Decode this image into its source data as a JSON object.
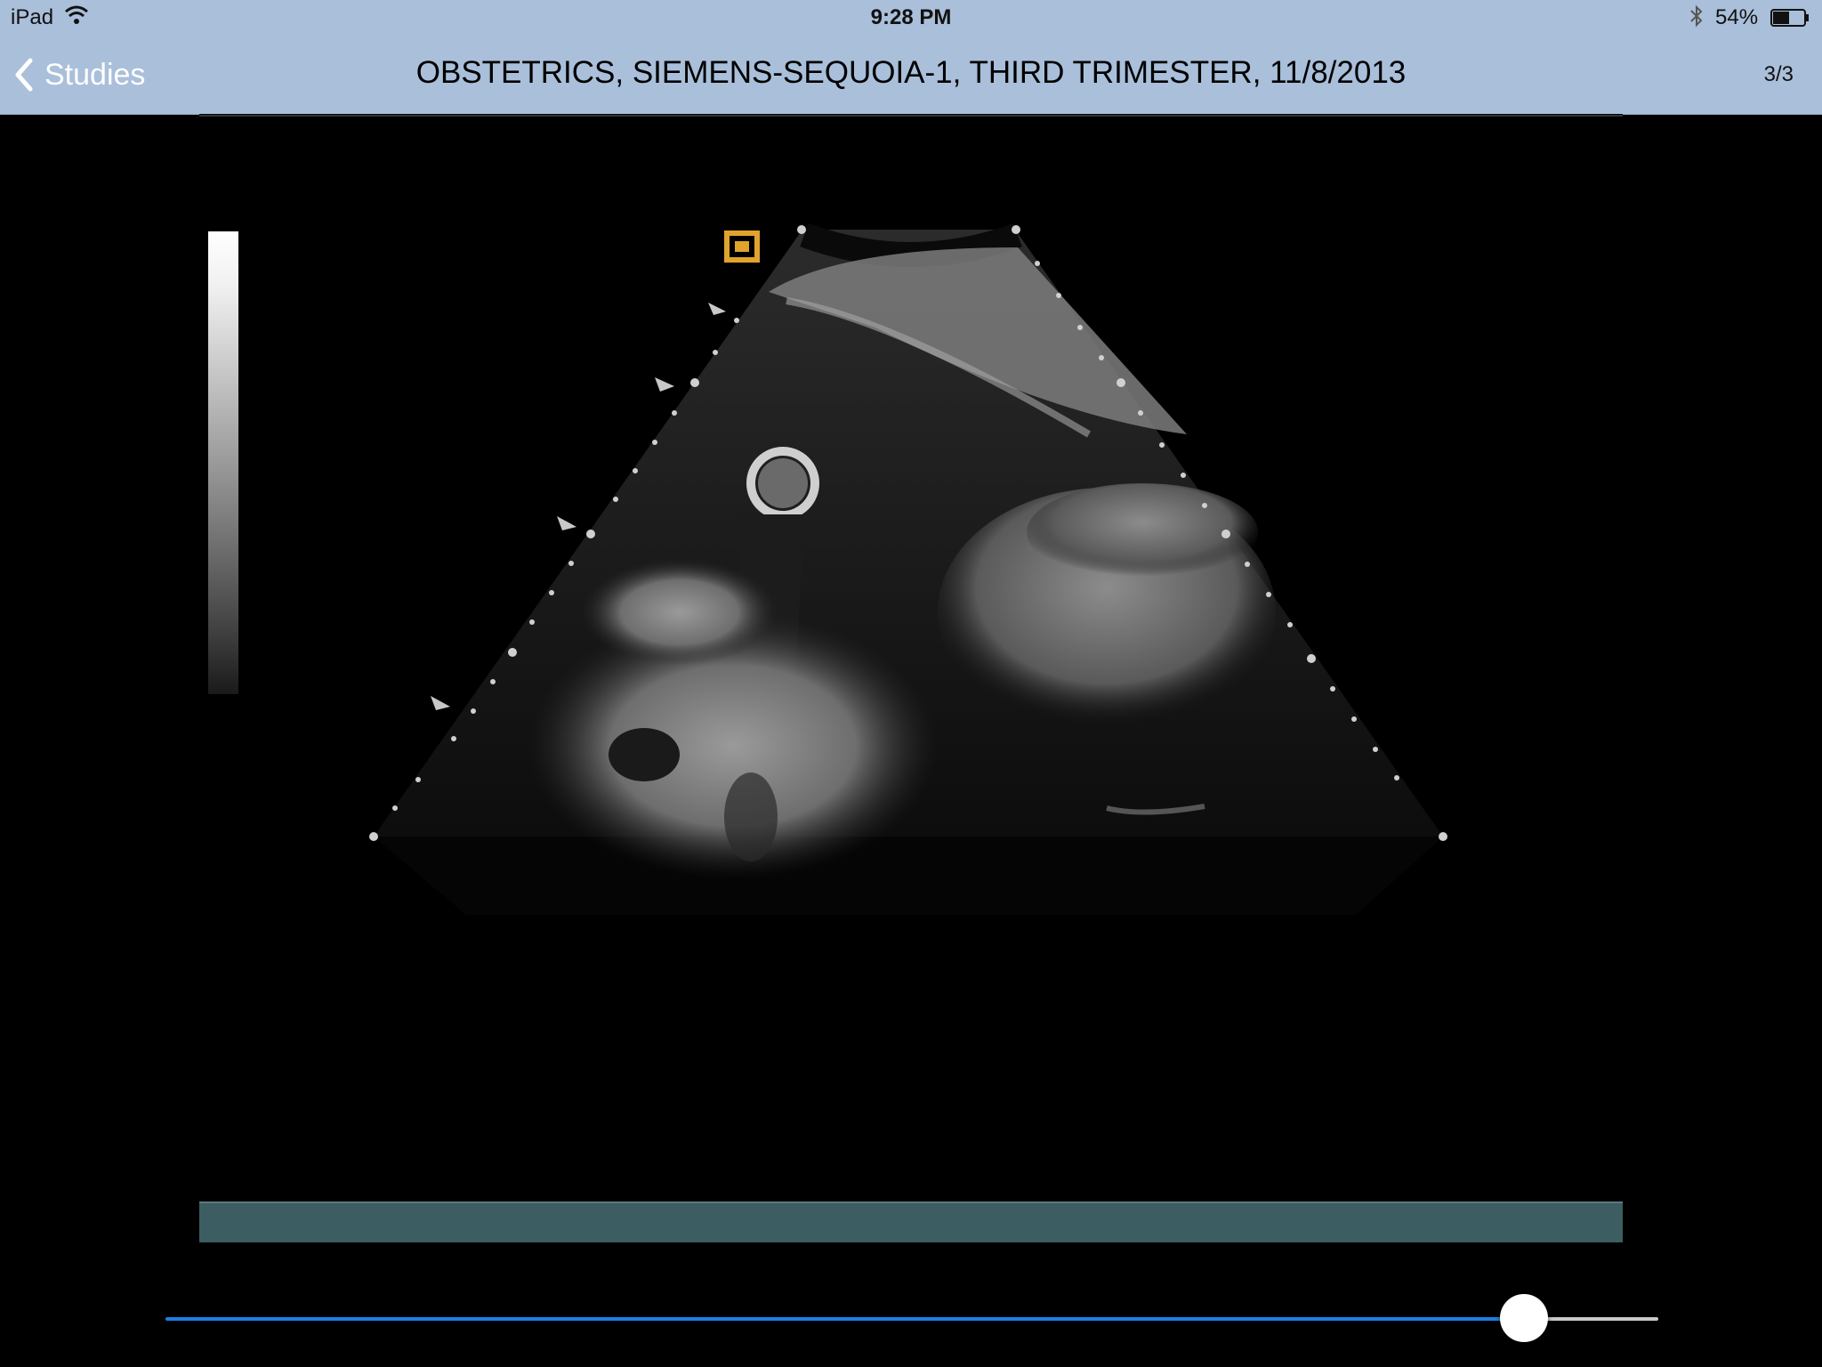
{
  "status_bar": {
    "device": "iPad",
    "time": "9:28 PM",
    "battery_percent": "54%",
    "battery_level": 0.54
  },
  "nav": {
    "back_label": "Studies",
    "title": "OBSTETRICS, SIEMENS-SEQUOIA-1, THIRD TRIMESTER, 11/8/2013",
    "page_count": "3/3"
  },
  "viewer": {
    "image_description": "ultrasound-frame",
    "cine_bar_color": "#3c5d61"
  },
  "slider": {
    "value": 0.91,
    "accent_color": "#1f7ee6"
  }
}
